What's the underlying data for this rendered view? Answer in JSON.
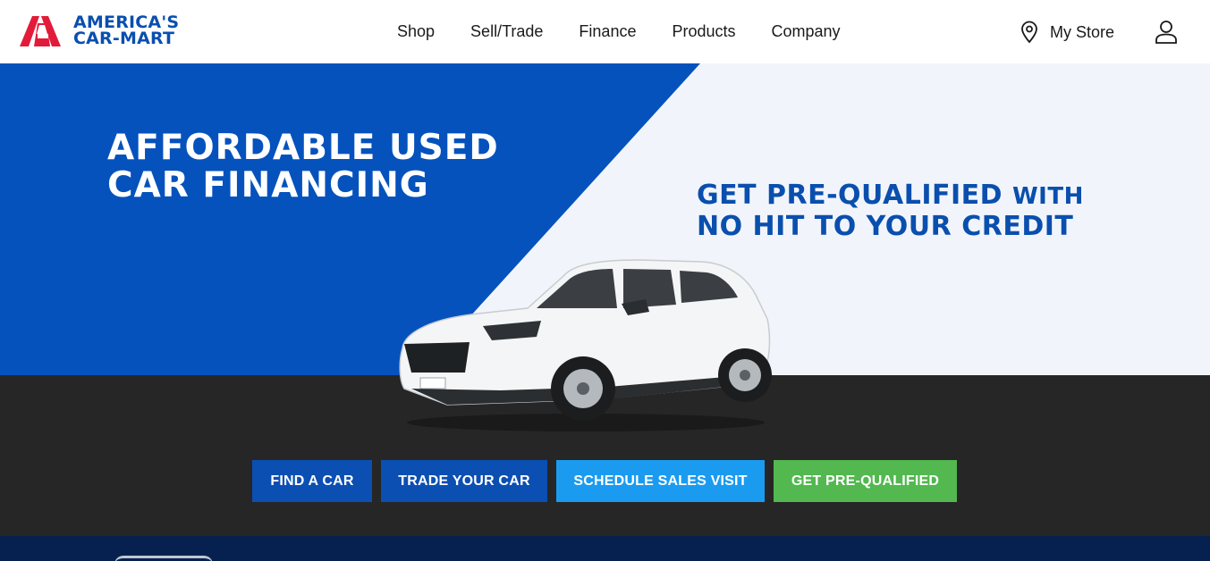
{
  "header": {
    "logo": {
      "line1": "AMERICA'S",
      "line2": "CAR-MART"
    },
    "nav": [
      {
        "label": "Shop"
      },
      {
        "label": "Sell/Trade"
      },
      {
        "label": "Finance"
      },
      {
        "label": "Products"
      },
      {
        "label": "Company"
      }
    ],
    "store_label": "My Store",
    "icons": {
      "store": "location-pin-icon",
      "account": "user-icon"
    }
  },
  "hero": {
    "title_line1": "AFFORDABLE USED",
    "title_line2": "CAR FINANCING",
    "sub_part1": "GET PRE-QUALIFIED",
    "sub_part2": "WITH",
    "sub_line2": "NO HIT TO YOUR CREDIT"
  },
  "actions": {
    "find_car": "FIND A CAR",
    "trade_car": "TRADE YOUR CAR",
    "schedule_visit": "SCHEDULE SALES VISIT",
    "pre_qualified": "GET PRE-QUALIFIED"
  },
  "colors": {
    "brand_blue": "#0a4fae",
    "hero_blue": "#0552bd",
    "brand_red": "#e31b3a",
    "hero_light": "#f1f5fb",
    "band_dark": "#262626",
    "schedule_button": "#1a9bf0",
    "prequal_button": "#52b84f",
    "footer_strip": "#06214f"
  }
}
